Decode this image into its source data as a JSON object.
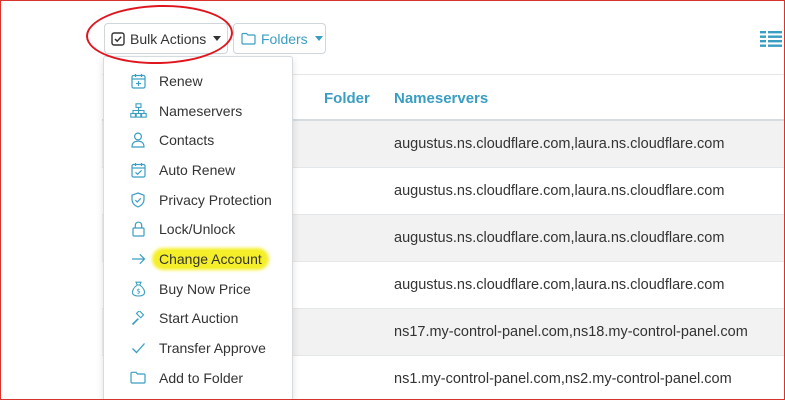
{
  "toolbar": {
    "bulk_actions_label": "Bulk Actions",
    "folders_label": "Folders",
    "accent": "#3a9ec2"
  },
  "table": {
    "columns": [
      "Folder",
      "Nameservers"
    ],
    "rows": [
      {
        "nameservers": "augustus.ns.cloudflare.com,laura.ns.cloudflare.com"
      },
      {
        "nameservers": "augustus.ns.cloudflare.com,laura.ns.cloudflare.com"
      },
      {
        "nameservers": "augustus.ns.cloudflare.com,laura.ns.cloudflare.com"
      },
      {
        "nameservers": "augustus.ns.cloudflare.com,laura.ns.cloudflare.com"
      },
      {
        "nameservers": "ns17.my-control-panel.com,ns18.my-control-panel.com"
      },
      {
        "nameservers": "ns1.my-control-panel.com,ns2.my-control-panel.com"
      }
    ]
  },
  "menu": {
    "items": [
      {
        "label": "Renew",
        "icon": "calendar-plus-icon"
      },
      {
        "label": "Nameservers",
        "icon": "sitemap-icon"
      },
      {
        "label": "Contacts",
        "icon": "user-icon"
      },
      {
        "label": "Auto Renew",
        "icon": "calendar-check-icon"
      },
      {
        "label": "Privacy Protection",
        "icon": "shield-icon"
      },
      {
        "label": "Lock/Unlock",
        "icon": "lock-icon"
      },
      {
        "label": "Change Account",
        "icon": "arrow-right-icon",
        "highlighted": true
      },
      {
        "label": "Buy Now Price",
        "icon": "money-bag-icon"
      },
      {
        "label": "Start Auction",
        "icon": "gavel-icon"
      },
      {
        "label": "Transfer Approve",
        "icon": "check-icon"
      },
      {
        "label": "Add to Folder",
        "icon": "folder-icon"
      }
    ]
  },
  "annotations": {
    "circle_color": "#e0161f",
    "highlight_color": "#f5ef2a"
  }
}
